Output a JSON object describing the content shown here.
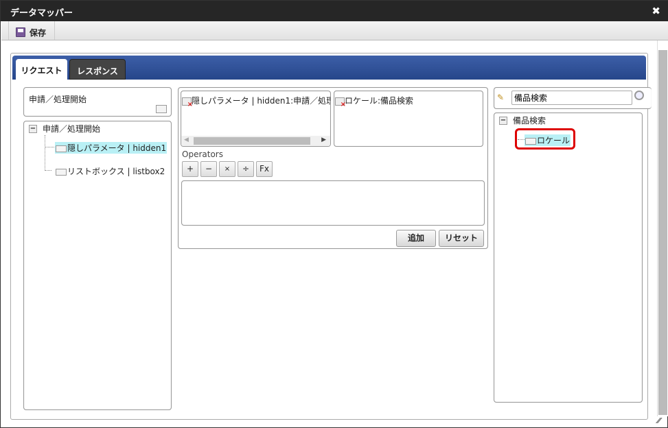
{
  "window": {
    "title": "データマッパー",
    "close_icon": "close-icon"
  },
  "toolbar": {
    "save_label": "保存"
  },
  "tabs": [
    {
      "label": "リクエスト",
      "active": true
    },
    {
      "label": "レスポンス",
      "active": false
    }
  ],
  "left": {
    "header_title": "申請／処理開始",
    "tree": {
      "root": "申請／処理開始",
      "children": [
        {
          "label": "隠しパラメータ | hidden1",
          "selected": true
        },
        {
          "label": "リストボックス | listbox2",
          "selected": false
        }
      ]
    }
  },
  "middle": {
    "source_item": "隠しパラメータ | hidden1:申請／処理開",
    "target_item": "ロケール:備品検索",
    "operators_label": "Operators",
    "operators": [
      "+",
      "−",
      "×",
      "÷",
      "Fx"
    ],
    "expression": "",
    "add_label": "追加",
    "reset_label": "リセット"
  },
  "right": {
    "search_value": "備品検索",
    "tree": {
      "root": "備品検索",
      "children": [
        {
          "label": "ロケール",
          "selected": true,
          "highlighted": true
        }
      ]
    }
  },
  "colors": {
    "tab_bar": "#2f4f94",
    "selection": "#b9f0f5",
    "highlight": "#dd0000"
  }
}
